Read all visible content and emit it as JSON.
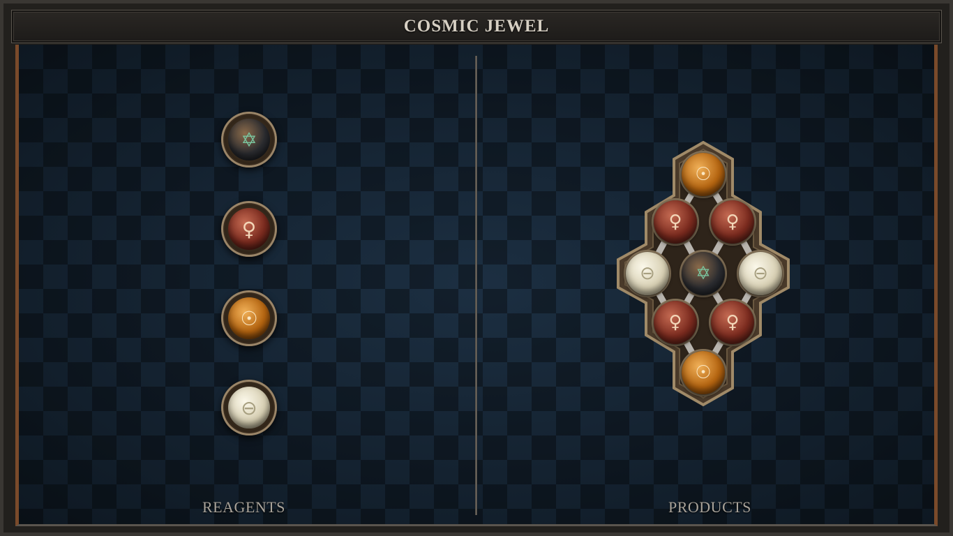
{
  "title": "COSMIC JEWEL",
  "reagents": {
    "label": "REAGENTS",
    "items": [
      {
        "name": "star",
        "glyph": "✡"
      },
      {
        "name": "venus",
        "glyph": "♀"
      },
      {
        "name": "sun",
        "glyph": "☉"
      },
      {
        "name": "moon",
        "glyph": "⊖"
      }
    ]
  },
  "products": {
    "label": "PRODUCTS",
    "items": [
      {
        "name": "sun",
        "glyph": "☉"
      },
      {
        "name": "venus",
        "glyph": "♀"
      },
      {
        "name": "venus",
        "glyph": "♀"
      },
      {
        "name": "moon",
        "glyph": "⊖"
      },
      {
        "name": "star",
        "glyph": "✡"
      },
      {
        "name": "moon",
        "glyph": "⊖"
      },
      {
        "name": "venus",
        "glyph": "♀"
      },
      {
        "name": "venus",
        "glyph": "♀"
      },
      {
        "name": "sun",
        "glyph": "☉"
      }
    ]
  }
}
